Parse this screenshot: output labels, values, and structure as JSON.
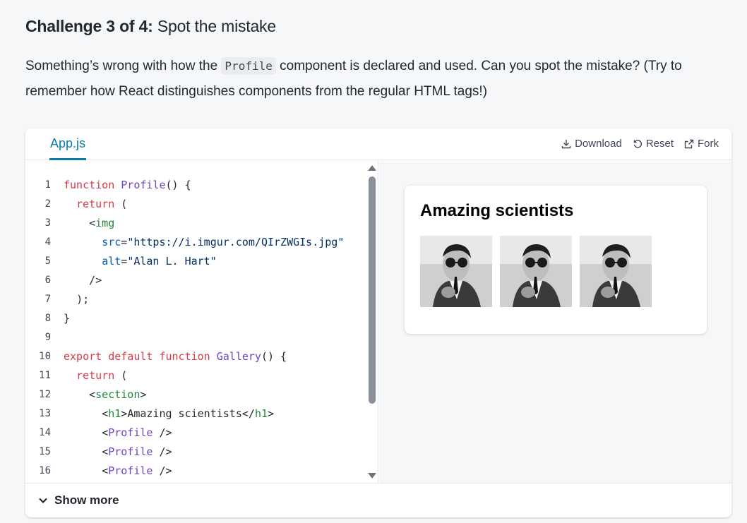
{
  "challenge": {
    "prefix": "Challenge 3 of 4:",
    "name": "Spot the mistake"
  },
  "description": {
    "before": "Something’s wrong with how the ",
    "code": "Profile",
    "after": " component is declared and used. Can you spot the mistake? (Try to remember how React distinguishes components from the regular HTML tags!)"
  },
  "sandbox": {
    "tab": "App.js",
    "actions": {
      "download": "Download",
      "reset": "Reset",
      "fork": "Fork"
    },
    "code_lines": [
      {
        "n": "1"
      },
      {
        "n": "2"
      },
      {
        "n": "3"
      },
      {
        "n": "4"
      },
      {
        "n": "5"
      },
      {
        "n": "6"
      },
      {
        "n": "7"
      },
      {
        "n": "8"
      },
      {
        "n": "9"
      },
      {
        "n": "10"
      },
      {
        "n": "11"
      },
      {
        "n": "12"
      },
      {
        "n": "13"
      },
      {
        "n": "14"
      },
      {
        "n": "15"
      },
      {
        "n": "16"
      }
    ],
    "code_text": {
      "l1_kw": "function",
      "l1_fn": "Profile",
      "l1_rest": "() {",
      "l2_kw": "return",
      "l2_rest": " (",
      "l3_lt": "<",
      "l3_tag": "img",
      "l4_attr": "src",
      "l4_eq": "=",
      "l4_str": "\"https://i.imgur.com/QIrZWGIs.jpg\"",
      "l5_attr": "alt",
      "l5_eq": "=",
      "l5_str": "\"Alan L. Hart\"",
      "l6": "/>",
      "l7": ");",
      "l8": "}",
      "l10_kw1": "export",
      "l10_kw2": "default",
      "l10_kw3": "function",
      "l10_fn": "Gallery",
      "l10_rest": "() {",
      "l11_kw": "return",
      "l11_rest": " (",
      "l12_lt": "<",
      "l12_tag": "section",
      "l12_gt": ">",
      "l13_lt": "<",
      "l13_tag": "h1",
      "l13_gt": ">",
      "l13_text": "Amazing scientists",
      "l13_close_lt": "</",
      "l13_close_tag": "h1",
      "l13_close_gt": ">",
      "l14_lt": "<",
      "l14_comp": "Profile",
      "l14_end": " />",
      "l15_lt": "<",
      "l15_comp": "Profile",
      "l15_end": " />",
      "l16_lt": "<",
      "l16_comp": "Profile",
      "l16_end": " />"
    },
    "preview": {
      "heading": "Amazing scientists",
      "image_alt": "Alan L. Hart",
      "image_count": 3
    },
    "show_more": "Show more"
  }
}
